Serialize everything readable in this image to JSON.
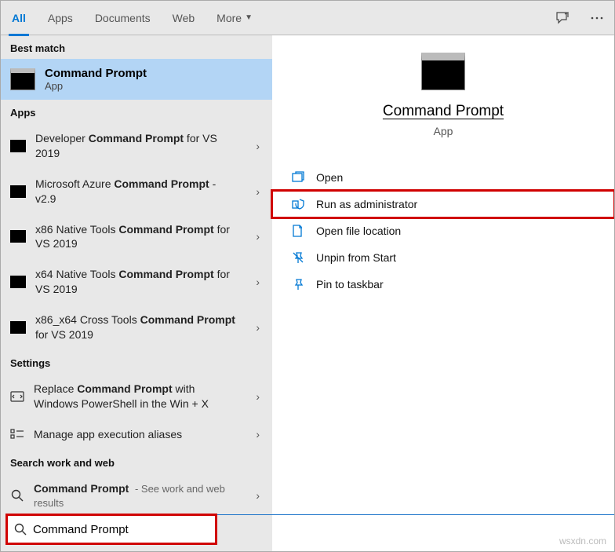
{
  "tabs": {
    "all": "All",
    "apps": "Apps",
    "documents": "Documents",
    "web": "Web",
    "more": "More"
  },
  "sections": {
    "best_match": "Best match",
    "apps": "Apps",
    "settings": "Settings",
    "search_web": "Search work and web"
  },
  "best_match": {
    "title": "Command Prompt",
    "subtitle": "App"
  },
  "apps_list": [
    {
      "pre": "Developer ",
      "bold": "Command Prompt",
      "post": " for VS 2019"
    },
    {
      "pre": "Microsoft Azure ",
      "bold": "Command Prompt",
      "post": " - v2.9"
    },
    {
      "pre": "x86 Native Tools ",
      "bold": "Command Prompt",
      "post": " for VS 2019"
    },
    {
      "pre": "x64 Native Tools ",
      "bold": "Command Prompt",
      "post": " for VS 2019"
    },
    {
      "pre": "x86_x64 Cross Tools ",
      "bold": "Command Prompt",
      "post": " for VS 2019"
    }
  ],
  "settings_list": [
    {
      "pre": "Replace ",
      "bold": "Command Prompt",
      "post": " with Windows PowerShell in the Win + X"
    },
    {
      "pre": "Manage app execution aliases",
      "bold": "",
      "post": ""
    }
  ],
  "web_list": [
    {
      "bold": "Command Prompt",
      "sub": " - See work and web results"
    }
  ],
  "details": {
    "title": "Command Prompt",
    "subtitle": "App",
    "actions": {
      "open": "Open",
      "run_admin": "Run as administrator",
      "open_loc": "Open file location",
      "unpin": "Unpin from Start",
      "pin_tb": "Pin to taskbar"
    }
  },
  "search": {
    "value": "Command Prompt"
  },
  "watermark": "wsxdn.com"
}
